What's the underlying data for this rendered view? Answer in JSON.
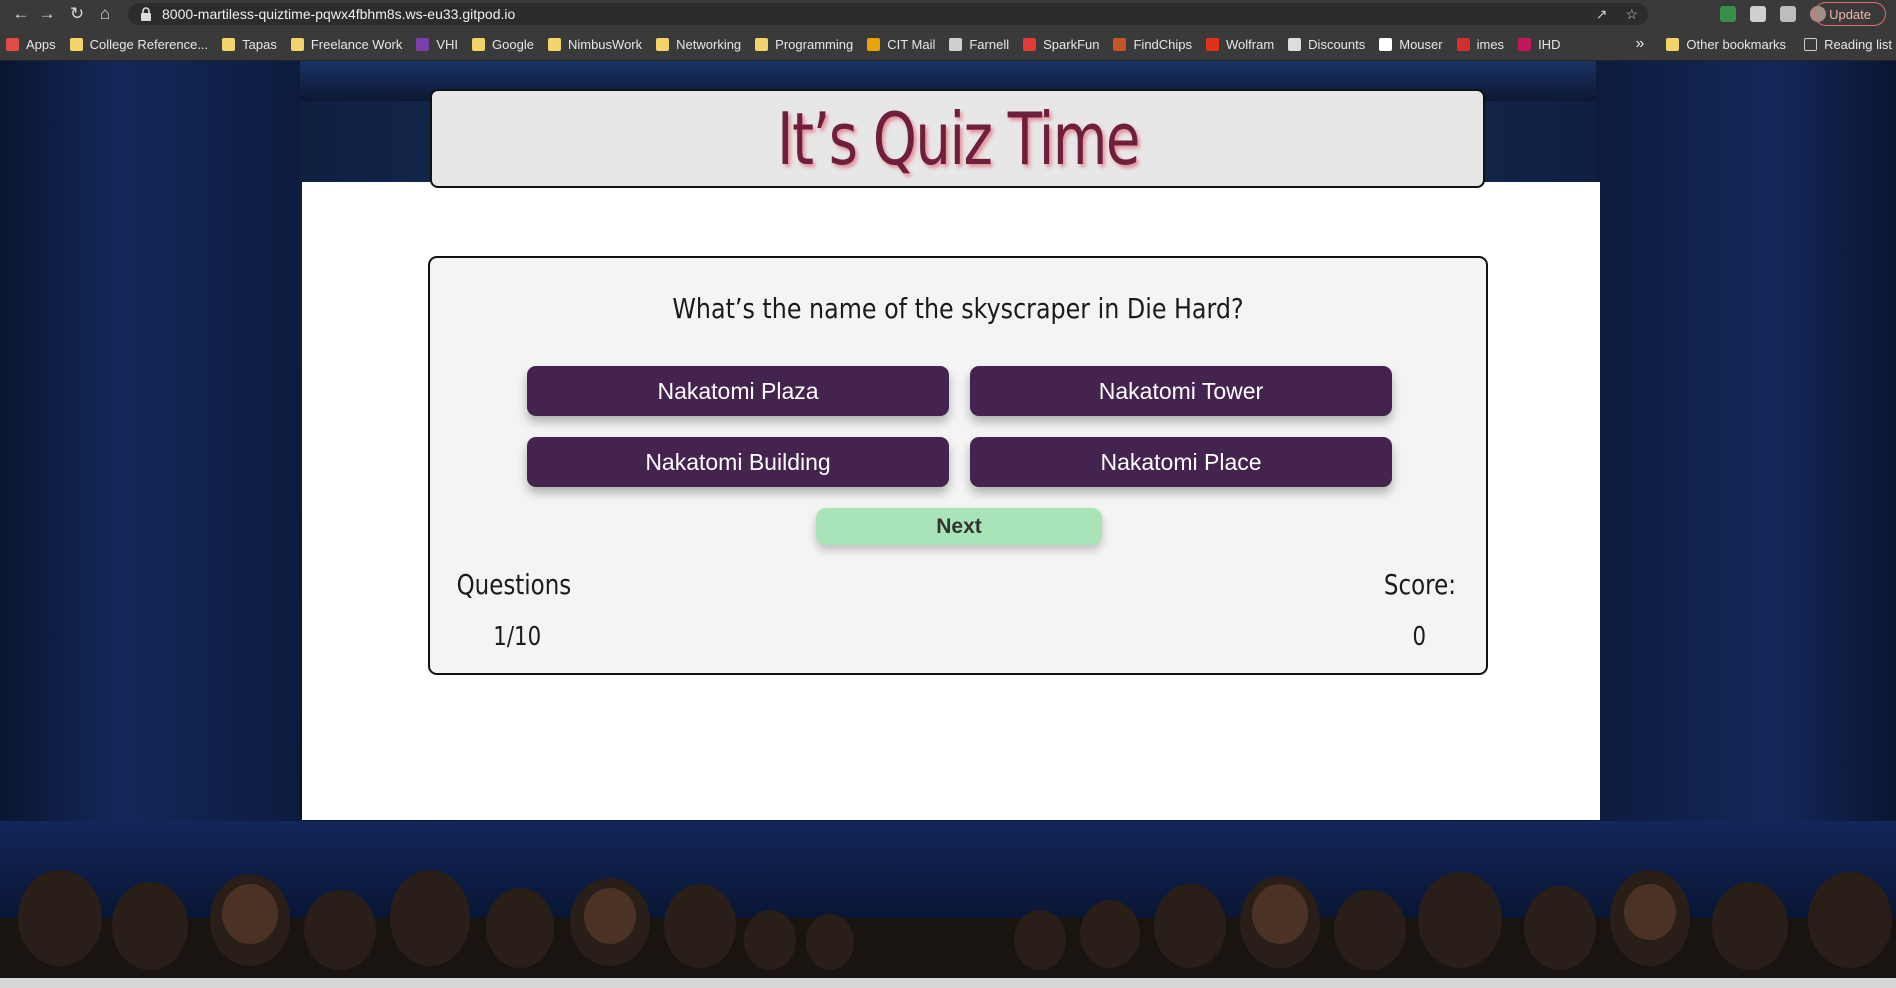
{
  "browser": {
    "url": "8000-martiless-quiztime-pqwx4fbhm8s.ws-eu33.gitpod.io",
    "update_label": "Update",
    "bookmarks": [
      {
        "label": "Apps",
        "icon": "apps-grid-icon",
        "color": "#e24a4a"
      },
      {
        "label": "College Reference...",
        "icon": "folder-icon",
        "color": "#f3d46a"
      },
      {
        "label": "Tapas",
        "icon": "folder-icon",
        "color": "#f3d46a"
      },
      {
        "label": "Freelance Work",
        "icon": "folder-icon",
        "color": "#f3d46a"
      },
      {
        "label": "VHI",
        "icon": "vhi-icon",
        "color": "#7a3fa8"
      },
      {
        "label": "Google",
        "icon": "folder-icon",
        "color": "#f3d46a"
      },
      {
        "label": "NimbusWork",
        "icon": "folder-icon",
        "color": "#f3d46a"
      },
      {
        "label": "Networking",
        "icon": "folder-icon",
        "color": "#f3d46a"
      },
      {
        "label": "Programming",
        "icon": "folder-icon",
        "color": "#f3d46a"
      },
      {
        "label": "CIT Mail",
        "icon": "mail-icon",
        "color": "#e8a400"
      },
      {
        "label": "Farnell",
        "icon": "farnell-icon",
        "color": "#cfcfcf"
      },
      {
        "label": "SparkFun",
        "icon": "sparkfun-icon",
        "color": "#e53935"
      },
      {
        "label": "FindChips",
        "icon": "findchips-icon",
        "color": "#c0562a"
      },
      {
        "label": "Wolfram",
        "icon": "wolfram-icon",
        "color": "#e0321b"
      },
      {
        "label": "Discounts",
        "icon": "discounts-icon",
        "color": "#dddddd"
      },
      {
        "label": "Mouser",
        "icon": "mouser-icon",
        "color": "#ffffff"
      },
      {
        "label": "imes",
        "icon": "imes-icon",
        "color": "#d32f2f"
      },
      {
        "label": "IHD",
        "icon": "ihd-icon",
        "color": "#c2185b"
      }
    ],
    "overflow_label": "»",
    "other_bookmarks": "Other bookmarks",
    "reading_list": "Reading list"
  },
  "quiz": {
    "title": "It’s Quiz Time",
    "question": "What’s the name of the skyscraper in Die Hard?",
    "answers": [
      "Nakatomi Plaza",
      "Nakatomi Tower",
      "Nakatomi Building",
      "Nakatomi Place"
    ],
    "next_label": "Next",
    "questions_label": "Questions",
    "questions_value": "1/10",
    "score_label": "Score:",
    "score_value": "0"
  },
  "colors": {
    "answer_button": "#45234f",
    "next_button": "#a9e3b8",
    "title_text": "#6e1f3c"
  }
}
